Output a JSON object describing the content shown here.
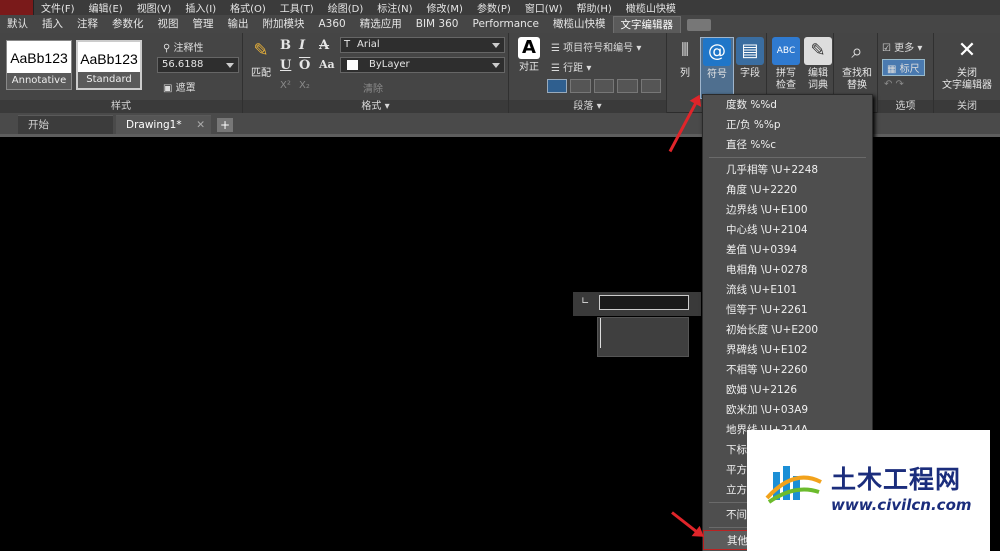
{
  "menubar": {
    "items": [
      "文件(F)",
      "编辑(E)",
      "视图(V)",
      "插入(I)",
      "格式(O)",
      "工具(T)",
      "绘图(D)",
      "标注(N)",
      "修改(M)",
      "参数(P)",
      "窗口(W)",
      "帮助(H)",
      "橄榄山快模"
    ]
  },
  "ribbon_tabs": {
    "items": [
      "默认",
      "插入",
      "注释",
      "参数化",
      "视图",
      "管理",
      "输出",
      "附加模块",
      "A360",
      "精选应用",
      "BIM 360",
      "Performance",
      "橄榄山快模",
      "文字编辑器"
    ],
    "active": "文字编辑器"
  },
  "style_panel": {
    "title": "样式",
    "style1_sample": "AaBb123",
    "style1_name": "Annotative",
    "style2_sample": "AaBb123",
    "style2_name": "Standard",
    "annotative_label": "注释性",
    "height_value": "56.6188",
    "mask_label": "遮罩"
  },
  "format_panel": {
    "title": "格式",
    "match_label": "匹配",
    "font_value": "Arial",
    "color_value": "ByLayer",
    "bold": "B",
    "italic": "I",
    "strike": "A",
    "underline": "U",
    "overline": "O",
    "superscript": "X²",
    "subscript": "X₂",
    "case": "Aa",
    "clear": "清除"
  },
  "paragraph_panel": {
    "title": "段落",
    "justify_label": "对正",
    "bullets_label": "项目符号和编号",
    "line_spacing_label": "行距"
  },
  "insert_panel": {
    "column_label": "列",
    "symbol_label": "符号",
    "field_label": "字段"
  },
  "spell_panel": {
    "spell_label1": "拼写",
    "spell_label2": "检查",
    "edit_label1": "编辑",
    "edit_label2": "词典"
  },
  "tools_panel": {
    "find_label1": "查找和",
    "find_label2": "替换"
  },
  "options_panel": {
    "title": "选项",
    "more_label": "更多",
    "ruler_label": "标尺"
  },
  "close_panel": {
    "title": "关闭",
    "close_label1": "关闭",
    "close_label2": "文字编辑器"
  },
  "doc_tabs": {
    "start": "开始",
    "drawing": "Drawing1*"
  },
  "symbol_menu": {
    "items": [
      {
        "label": "度数  %%d"
      },
      {
        "label": "正/负  %%p"
      },
      {
        "label": "直径  %%c"
      },
      {
        "sep": true
      },
      {
        "label": "几乎相等  \\U+2248"
      },
      {
        "label": "角度  \\U+2220"
      },
      {
        "label": "边界线  \\U+E100"
      },
      {
        "label": "中心线  \\U+2104"
      },
      {
        "label": "差值  \\U+0394"
      },
      {
        "label": "电相角  \\U+0278"
      },
      {
        "label": "流线  \\U+E101"
      },
      {
        "label": "恒等于  \\U+2261"
      },
      {
        "label": "初始长度  \\U+E200"
      },
      {
        "label": "界碑线  \\U+E102"
      },
      {
        "label": "不相等  \\U+2260"
      },
      {
        "label": "欧姆  \\U+2126"
      },
      {
        "label": "欧米加  \\U+03A9"
      },
      {
        "label": "地界线  \\U+214A"
      },
      {
        "label": "下标"
      },
      {
        "label": "平方"
      },
      {
        "label": "立方"
      },
      {
        "sep": true
      },
      {
        "label": "不间"
      },
      {
        "sep": true
      },
      {
        "label": "其他",
        "highlight": true
      }
    ]
  },
  "watermark": {
    "title": "土木工程网",
    "url": "www.civilcn.com"
  },
  "colors": {
    "accent_red": "#e0252a",
    "symbol_blue": "#1f76c8",
    "watermark_blue": "#1b2d7c"
  }
}
